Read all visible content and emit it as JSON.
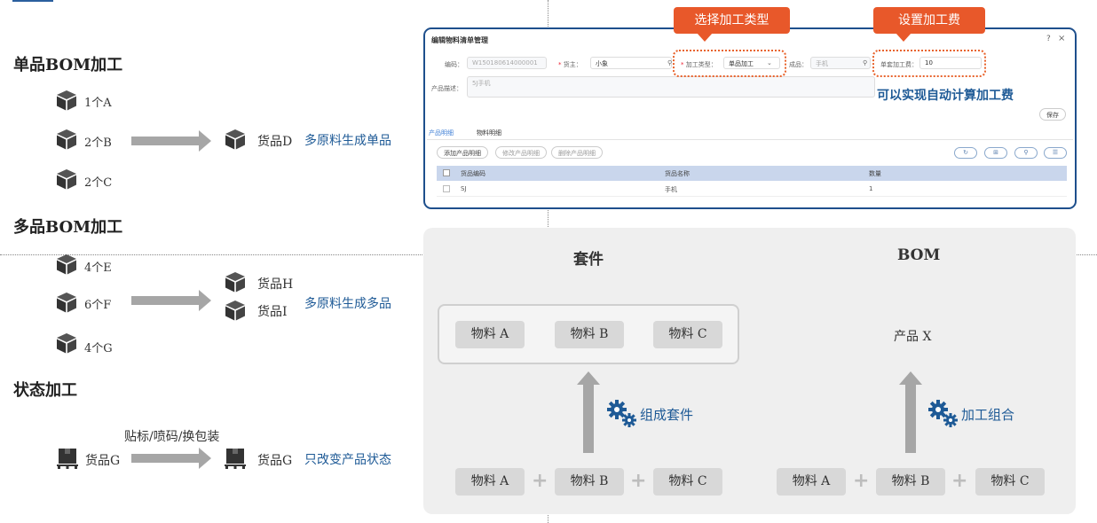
{
  "left": {
    "single_bom": {
      "title": "单品BOM加工",
      "materials": [
        "1个A",
        "2个B",
        "2个C"
      ],
      "output": "货品D",
      "note": "多原料生成单品"
    },
    "multi_bom": {
      "title": "多品BOM加工",
      "materials": [
        "4个E",
        "6个F",
        "4个G"
      ],
      "outputs": [
        "货品H",
        "货品I"
      ],
      "note": "多原料生成多品"
    },
    "state": {
      "title": "状态加工",
      "input": "货品G",
      "process": "贴标/喷码/换包装",
      "output": "货品G",
      "note": "只改变产品状态"
    }
  },
  "window": {
    "title": "编辑物料清单管理",
    "help_icon": "?",
    "close_icon": "×",
    "code_label": "编码：",
    "code_value": "W150180614000001",
    "owner_label": "货主：",
    "owner_value": "小象",
    "type_label": "加工类型：",
    "type_value": "单品加工",
    "product_label": "成品：",
    "product_value": "手机",
    "fee_label": "单套加工费：",
    "fee_value": "10",
    "desc_label": "产品描述：",
    "desc_value": "5J手机",
    "save_button": "保存",
    "tabs": [
      "产品明细",
      "物料明细"
    ],
    "toolbar_buttons": [
      "添加产品明细",
      "修改产品明细",
      "删除产品明细"
    ],
    "table": {
      "headers": [
        "货品编码",
        "货品名称",
        "数量"
      ],
      "rows": [
        [
          "SJ",
          "手机",
          "1"
        ]
      ]
    }
  },
  "callouts": {
    "select_type": "选择加工类型",
    "set_fee": "设置加工费",
    "auto_calc": "可以实现自动计算加工费"
  },
  "panel": {
    "kit": {
      "title": "套件",
      "top_materials": [
        "物料 A",
        "物料 B",
        "物料 C"
      ],
      "action": "组成套件",
      "bottom_materials": [
        "物料 A",
        "物料 B",
        "物料 C"
      ]
    },
    "bom": {
      "title": "BOM",
      "product": "产品 X",
      "action": "加工组合",
      "bottom_materials": [
        "物料 A",
        "物料 B",
        "物料 C"
      ]
    }
  },
  "colors": {
    "accent_blue": "#1e5a96",
    "callout_orange": "#e8582a",
    "window_border": "#1e4f8c",
    "arrow_gray": "#a6a6a6"
  }
}
